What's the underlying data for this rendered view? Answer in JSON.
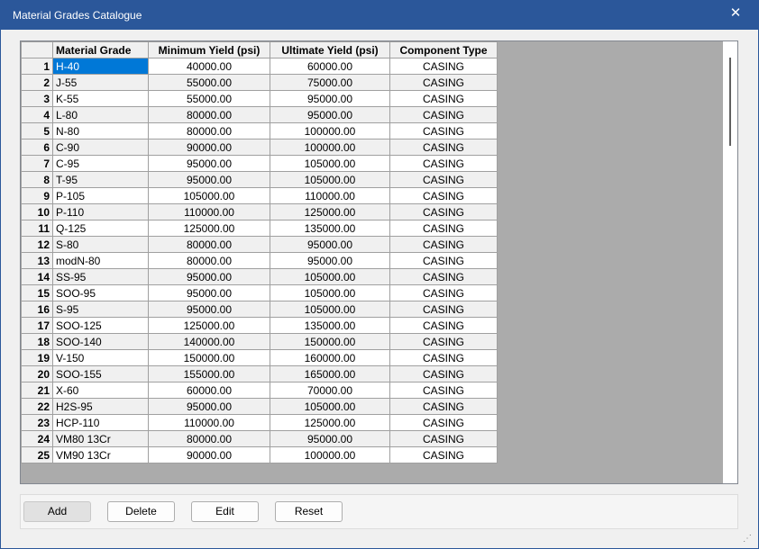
{
  "window": {
    "title": "Material Grades Catalogue",
    "close_glyph": "✕"
  },
  "table": {
    "columns": [
      "Material Grade",
      "Minimum Yield (psi)",
      "Ultimate Yield (psi)",
      "Component Type"
    ],
    "rows": [
      {
        "n": "1",
        "grade": "H-40",
        "min": "40000.00",
        "ult": "60000.00",
        "type": "CASING"
      },
      {
        "n": "2",
        "grade": "J-55",
        "min": "55000.00",
        "ult": "75000.00",
        "type": "CASING"
      },
      {
        "n": "3",
        "grade": "K-55",
        "min": "55000.00",
        "ult": "95000.00",
        "type": "CASING"
      },
      {
        "n": "4",
        "grade": "L-80",
        "min": "80000.00",
        "ult": "95000.00",
        "type": "CASING"
      },
      {
        "n": "5",
        "grade": "N-80",
        "min": "80000.00",
        "ult": "100000.00",
        "type": "CASING"
      },
      {
        "n": "6",
        "grade": "C-90",
        "min": "90000.00",
        "ult": "100000.00",
        "type": "CASING"
      },
      {
        "n": "7",
        "grade": "C-95",
        "min": "95000.00",
        "ult": "105000.00",
        "type": "CASING"
      },
      {
        "n": "8",
        "grade": "T-95",
        "min": "95000.00",
        "ult": "105000.00",
        "type": "CASING"
      },
      {
        "n": "9",
        "grade": "P-105",
        "min": "105000.00",
        "ult": "110000.00",
        "type": "CASING"
      },
      {
        "n": "10",
        "grade": "P-110",
        "min": "110000.00",
        "ult": "125000.00",
        "type": "CASING"
      },
      {
        "n": "11",
        "grade": "Q-125",
        "min": "125000.00",
        "ult": "135000.00",
        "type": "CASING"
      },
      {
        "n": "12",
        "grade": "S-80",
        "min": "80000.00",
        "ult": "95000.00",
        "type": "CASING"
      },
      {
        "n": "13",
        "grade": "modN-80",
        "min": "80000.00",
        "ult": "95000.00",
        "type": "CASING"
      },
      {
        "n": "14",
        "grade": "SS-95",
        "min": "95000.00",
        "ult": "105000.00",
        "type": "CASING"
      },
      {
        "n": "15",
        "grade": "SOO-95",
        "min": "95000.00",
        "ult": "105000.00",
        "type": "CASING"
      },
      {
        "n": "16",
        "grade": "S-95",
        "min": "95000.00",
        "ult": "105000.00",
        "type": "CASING"
      },
      {
        "n": "17",
        "grade": "SOO-125",
        "min": "125000.00",
        "ult": "135000.00",
        "type": "CASING"
      },
      {
        "n": "18",
        "grade": "SOO-140",
        "min": "140000.00",
        "ult": "150000.00",
        "type": "CASING"
      },
      {
        "n": "19",
        "grade": "V-150",
        "min": "150000.00",
        "ult": "160000.00",
        "type": "CASING"
      },
      {
        "n": "20",
        "grade": "SOO-155",
        "min": "155000.00",
        "ult": "165000.00",
        "type": "CASING"
      },
      {
        "n": "21",
        "grade": "X-60",
        "min": "60000.00",
        "ult": "70000.00",
        "type": "CASING"
      },
      {
        "n": "22",
        "grade": "H2S-95",
        "min": "95000.00",
        "ult": "105000.00",
        "type": "CASING"
      },
      {
        "n": "23",
        "grade": "HCP-110",
        "min": "110000.00",
        "ult": "125000.00",
        "type": "CASING"
      },
      {
        "n": "24",
        "grade": "VM80 13Cr",
        "min": "80000.00",
        "ult": "95000.00",
        "type": "CASING"
      },
      {
        "n": "25",
        "grade": "VM90 13Cr",
        "min": "90000.00",
        "ult": "100000.00",
        "type": "CASING"
      }
    ]
  },
  "buttons": {
    "add": "Add",
    "delete": "Delete",
    "edit": "Edit",
    "reset": "Reset"
  },
  "colors": {
    "titlebar": "#2b579a",
    "selection": "#0078d7"
  }
}
